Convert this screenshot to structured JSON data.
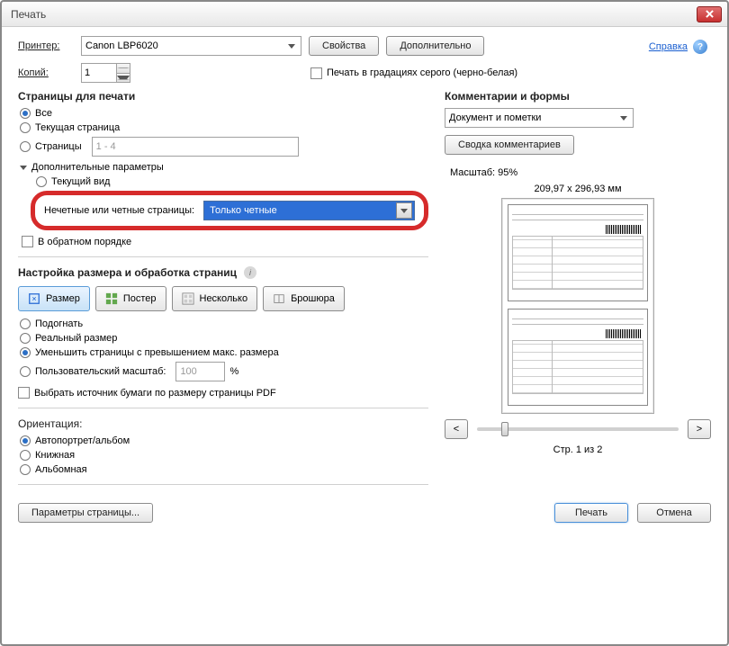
{
  "title": "Печать",
  "printer": {
    "label": "Принтер:",
    "value": "Canon LBP6020",
    "properties_btn": "Свойства",
    "advanced_btn": "Дополнительно"
  },
  "copies": {
    "label": "Копий:",
    "value": "1"
  },
  "grayscale_label": "Печать в градациях серого (черно-белая)",
  "help_link": "Справка",
  "pages": {
    "section": "Страницы для печати",
    "all": "Все",
    "current": "Текущая страница",
    "pages_label": "Страницы",
    "range": "1 - 4",
    "more": "Дополнительные параметры",
    "current_view": "Текущий вид",
    "odd_even_label": "Нечетные или четные страницы:",
    "odd_even_value": "Только четные",
    "reverse": "В обратном порядке"
  },
  "sizing": {
    "section": "Настройка размера и обработка страниц",
    "size": "Размер",
    "poster": "Постер",
    "multiple": "Несколько",
    "booklet": "Брошюра",
    "fit": "Подогнать",
    "actual": "Реальный размер",
    "shrink": "Уменьшить страницы с превышением макс. размера",
    "custom": "Пользовательский масштаб:",
    "custom_value": "100",
    "percent": "%",
    "choose_source": "Выбрать источник бумаги по размеру страницы PDF"
  },
  "orientation": {
    "section": "Ориентация:",
    "auto": "Автопортрет/альбом",
    "portrait": "Книжная",
    "landscape": "Альбомная"
  },
  "comments": {
    "section": "Комментарии и формы",
    "value": "Документ и пометки",
    "summary_btn": "Сводка комментариев"
  },
  "preview": {
    "scale_label": "Масштаб:  95%",
    "dimensions": "209,97 x 296,93 мм",
    "page_info": "Стр. 1 из 2",
    "prev": "<",
    "next": ">"
  },
  "footer": {
    "page_setup": "Параметры страницы...",
    "print": "Печать",
    "cancel": "Отмена"
  }
}
